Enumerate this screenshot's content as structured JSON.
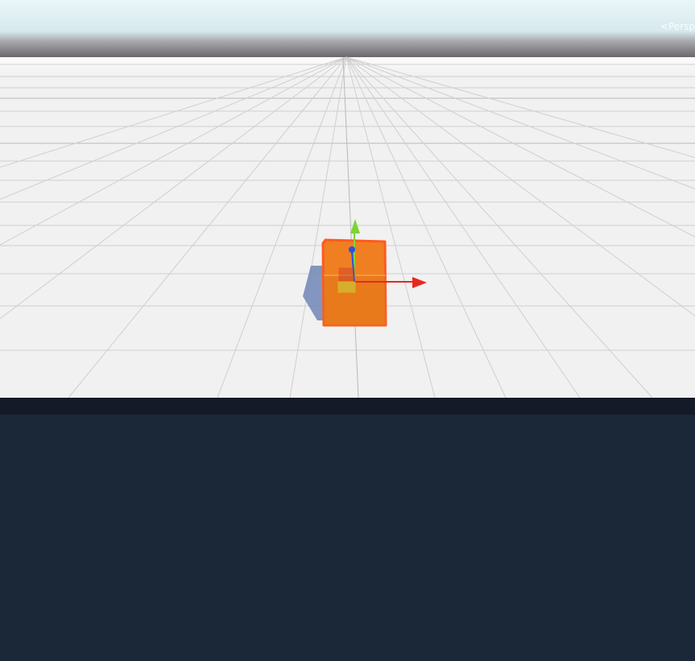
{
  "scene": {
    "persp_label": "<Persp",
    "sky_colors": [
      "#e9f6f8",
      "#dcecf0",
      "#6f6a6f"
    ],
    "ground_color": "#f1f1f1",
    "cube_color": "#f07f22",
    "selection_outline_color": "#ff5a1f",
    "gizmo": {
      "x_axis_color": "#e8281e",
      "y_axis_color": "#7fd336",
      "z_axis_color": "#2a4fe0"
    }
  },
  "panels": {
    "divider_color": "#151a28",
    "lower_panel_color": "#1b2838"
  }
}
